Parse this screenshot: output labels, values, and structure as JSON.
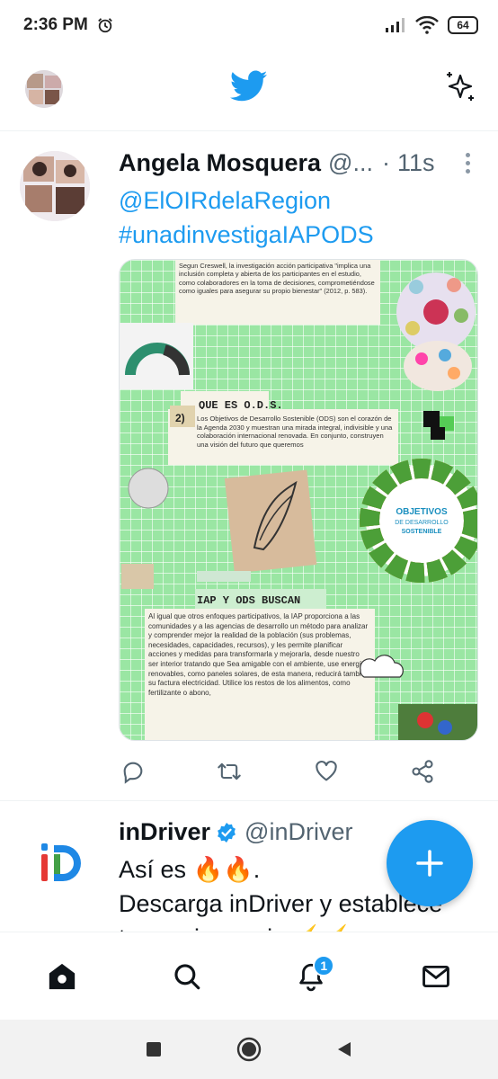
{
  "status_bar": {
    "time": "2:36 PM",
    "battery": "64"
  },
  "tweet": {
    "name": "Angela Mosquera",
    "handle": "@...",
    "separator": "·",
    "time": "11s",
    "mention": "@ElOIRdelaRegion",
    "hashtag": "#unadinvestigaIAPODS",
    "media": {
      "quote": "Segun Creswell, la investigación acción participativa \"implica una inclusión completa y abierta de los participantes en el estudio, como colaboradores en la toma de decisiones, comprometiéndose como iguales para asegurar su propio bienestar\" (2012, p. 583).",
      "section2_number": "2)",
      "section2_title": "QUE ES O.D.S.",
      "section2_text": "Los Objetivos de Desarrollo Sostenible (ODS) son el corazón de la Agenda 2030 y muestran una mirada integral, indivisible y una colaboración internacional renovada. En conjunto, construyen una visión del futuro que queremos",
      "ods_wheel_label_1": "OBJETIVOS",
      "ods_wheel_label_2": "DE DESARROLLO",
      "ods_wheel_label_3": "SOSTENIBLE",
      "section3_title": "IAP Y ODS  BUSCAN",
      "section3_text": "Al igual que otros enfoques participativos, la IAP proporciona a las comunidades y a las agencias de desarrollo un método para analizar y comprender mejor la realidad de la población (sus problemas, necesidades, capacidades, recursos), y les permite planificar acciones y medidas para transformarla y mejorarla, desde nuestro ser interior tratando que Sea amigable con el ambiente, use energías renovables, como paneles solares, de esta manera, reducirá también su factura electricidad. Utilice los restos de los alimentos, como fertilizante o abono,"
    }
  },
  "tweet2": {
    "name": "inDriver",
    "handle": "@inDriver",
    "line1": "Así es 🔥🔥.",
    "line2": "Descarga inDriver y establece",
    "line3": "tu propio precio ⚡⚡"
  },
  "bottom_nav": {
    "notifications_badge": "1"
  },
  "colors": {
    "twitter_blue": "#1d9bf0",
    "text": "#0f1419",
    "secondary": "#536471",
    "grid_green": "#8fe39a"
  },
  "icons": [
    "alarm-icon",
    "signal-icon",
    "wifi-icon",
    "battery-icon",
    "twitter-bird-icon",
    "sparkle-icon",
    "more-icon",
    "reply-icon",
    "retweet-icon",
    "like-icon",
    "share-icon",
    "verified-icon",
    "plus-icon",
    "home-icon",
    "search-icon",
    "bell-icon",
    "mail-icon",
    "recents-icon",
    "home-circle-icon",
    "back-icon"
  ]
}
